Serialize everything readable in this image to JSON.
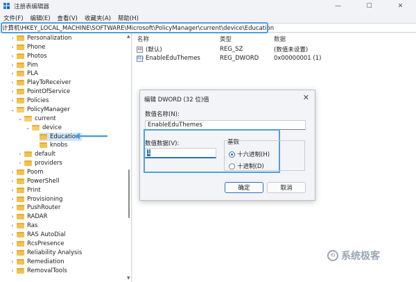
{
  "window": {
    "title": "注册表编辑器",
    "minimize": "—",
    "maximize": "☐",
    "close": "✕"
  },
  "menu": [
    "文件(F)",
    "编辑(E)",
    "查看(V)",
    "收藏夹(A)",
    "帮助(H)"
  ],
  "address": "计算机\\HKEY_LOCAL_MACHINE\\SOFTWARE\\Microsoft\\PolicyManager\\current\\device\\Education",
  "tree": [
    {
      "label": "Personalization",
      "expanded": false
    },
    {
      "label": "Phone",
      "expanded": false
    },
    {
      "label": "Photos",
      "expanded": false
    },
    {
      "label": "Pim",
      "expanded": false
    },
    {
      "label": "PLA",
      "expanded": false
    },
    {
      "label": "PlayToReceiver",
      "expanded": false
    },
    {
      "label": "PointOfService",
      "expanded": false
    },
    {
      "label": "Policies",
      "expanded": false
    },
    {
      "label": "PolicyManager",
      "expanded": true
    },
    {
      "label": "current",
      "expanded": true
    },
    {
      "label": "device",
      "expanded": true
    },
    {
      "label": "Education",
      "expanded": false,
      "selected": true
    },
    {
      "label": "knobs",
      "expanded": false
    },
    {
      "label": "default",
      "expanded": false
    },
    {
      "label": "providers",
      "expanded": false
    },
    {
      "label": "Poom",
      "expanded": false
    },
    {
      "label": "PowerShell",
      "expanded": false
    },
    {
      "label": "Print",
      "expanded": false
    },
    {
      "label": "Provisioning",
      "expanded": false
    },
    {
      "label": "PushRouter",
      "expanded": false
    },
    {
      "label": "RADAR",
      "expanded": false
    },
    {
      "label": "Ras",
      "expanded": false
    },
    {
      "label": "RAS AutoDial",
      "expanded": false
    },
    {
      "label": "RcsPresence",
      "expanded": false
    },
    {
      "label": "Reliability Analysis",
      "expanded": false
    },
    {
      "label": "Remediation",
      "expanded": false
    },
    {
      "label": "RemovalTools",
      "expanded": false
    }
  ],
  "list": {
    "headers": {
      "name": "名称",
      "type": "类型",
      "data": "数据"
    },
    "rows": [
      {
        "icon": "ab",
        "name": "(默认)",
        "type": "REG_SZ",
        "data": "(数值未设置)"
      },
      {
        "icon": "011",
        "name": "EnableEduThemes",
        "type": "REG_DWORD",
        "data": "0x00000001 (1)"
      }
    ]
  },
  "dialog": {
    "title": "编辑 DWORD (32 位)值",
    "close": "✕",
    "name_label": "数值名称(N):",
    "name_value": "EnableEduThemes",
    "data_label": "数值数据(V):",
    "data_value": "1",
    "base_label": "基数",
    "radio_hex": "十六进制(H)",
    "radio_dec": "十进制(D)",
    "hex_selected": true,
    "ok": "确定",
    "cancel": "取消"
  },
  "watermark": {
    "icon": "⟲",
    "text": "系统极客"
  },
  "colors": {
    "accent": "#2a6fc6",
    "highlight": "#4f9fd9",
    "folder": "#f3c24e"
  }
}
